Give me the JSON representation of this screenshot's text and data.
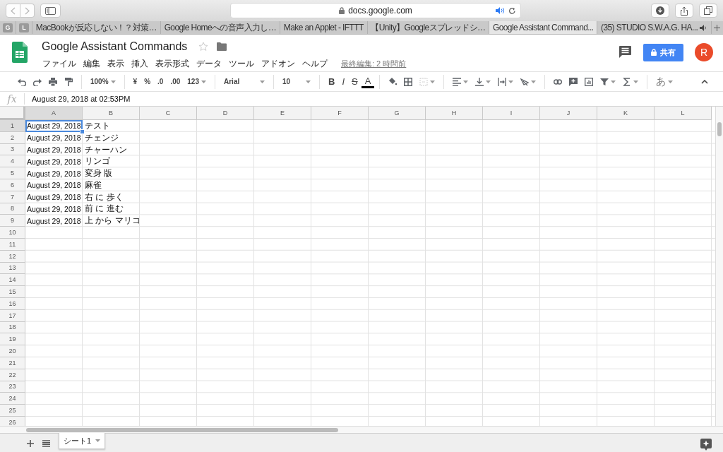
{
  "browser": {
    "address": "docs.google.com",
    "pinned_tabs": [
      "G",
      "L"
    ],
    "tabs": [
      {
        "label": "MacBookが反応しない！？対策…",
        "selected": false,
        "audio": false
      },
      {
        "label": "Google Homeへの音声入力し…",
        "selected": false,
        "audio": false
      },
      {
        "label": "Make an Applet - IFTTT",
        "selected": false,
        "audio": false
      },
      {
        "label": "【Unity】Googleスプレッドシ…",
        "selected": false,
        "audio": false
      },
      {
        "label": "Google Assistant Command...",
        "selected": true,
        "audio": false
      },
      {
        "label": "(35) STUDIO S.W.A.G. HA...",
        "selected": false,
        "audio": true
      }
    ]
  },
  "document": {
    "title": "Google Assistant Commands",
    "menu": [
      "ファイル",
      "編集",
      "表示",
      "挿入",
      "表示形式",
      "データ",
      "ツール",
      "アドオン",
      "ヘルプ"
    ],
    "last_edit": "最終編集: 2 時間前",
    "share": "共有",
    "avatar": "R"
  },
  "toolbar": {
    "zoom": "100%",
    "currency": "¥",
    "percent": "%",
    "decrease_decimal": ".0",
    "increase_decimal": ".00",
    "number_format": "123",
    "font": "Arial",
    "font_size": "10",
    "bold": "B",
    "italic": "I",
    "strikethrough": "S",
    "text_color": "A",
    "input_tools": "あ"
  },
  "formula_bar": {
    "label": "fx",
    "value": "August 29, 2018 at 02:53PM"
  },
  "sheet": {
    "columns": [
      {
        "label": "A",
        "selected": true
      },
      {
        "label": "B",
        "selected": false
      },
      {
        "label": "C",
        "selected": false
      },
      {
        "label": "D",
        "selected": false
      },
      {
        "label": "E",
        "selected": false
      },
      {
        "label": "F",
        "selected": false
      },
      {
        "label": "G",
        "selected": false
      },
      {
        "label": "H",
        "selected": false
      },
      {
        "label": "I",
        "selected": false
      },
      {
        "label": "J",
        "selected": false
      },
      {
        "label": "K",
        "selected": false
      },
      {
        "label": "L",
        "selected": false
      }
    ],
    "rows": [
      {
        "number": "1",
        "selected": true,
        "cells": [
          {
            "text": "August 29, 2018",
            "selected": true
          },
          {
            "text": "テスト",
            "selected": false
          }
        ]
      },
      {
        "number": "2",
        "selected": false,
        "cells": [
          {
            "text": "August 29, 2018",
            "selected": false
          },
          {
            "text": "チェンジ",
            "selected": false
          }
        ]
      },
      {
        "number": "3",
        "selected": false,
        "cells": [
          {
            "text": "August 29, 2018",
            "selected": false
          },
          {
            "text": "チャーハン",
            "selected": false
          }
        ]
      },
      {
        "number": "4",
        "selected": false,
        "cells": [
          {
            "text": "August 29, 2018",
            "selected": false
          },
          {
            "text": "リンゴ",
            "selected": false
          }
        ]
      },
      {
        "number": "5",
        "selected": false,
        "cells": [
          {
            "text": "August 29, 2018",
            "selected": false
          },
          {
            "text": "変身 版",
            "selected": false
          }
        ]
      },
      {
        "number": "6",
        "selected": false,
        "cells": [
          {
            "text": "August 29, 2018",
            "selected": false
          },
          {
            "text": "麻雀",
            "selected": false
          }
        ]
      },
      {
        "number": "7",
        "selected": false,
        "cells": [
          {
            "text": "August 29, 2018",
            "selected": false
          },
          {
            "text": "右 に 歩く",
            "selected": false
          }
        ]
      },
      {
        "number": "8",
        "selected": false,
        "cells": [
          {
            "text": "August 29, 2018",
            "selected": false
          },
          {
            "text": "前 に 進む",
            "selected": false
          }
        ]
      },
      {
        "number": "9",
        "selected": false,
        "cells": [
          {
            "text": "August 29, 2018",
            "selected": false
          },
          {
            "text": "上 から マリコ",
            "selected": false
          }
        ]
      },
      {
        "number": "10",
        "selected": false
      },
      {
        "number": "11",
        "selected": false
      },
      {
        "number": "12",
        "selected": false
      },
      {
        "number": "13",
        "selected": false
      },
      {
        "number": "14",
        "selected": false
      },
      {
        "number": "15",
        "selected": false
      },
      {
        "number": "16",
        "selected": false
      },
      {
        "number": "17",
        "selected": false
      },
      {
        "number": "18",
        "selected": false
      },
      {
        "number": "19",
        "selected": false
      },
      {
        "number": "20",
        "selected": false
      },
      {
        "number": "21",
        "selected": false
      },
      {
        "number": "22",
        "selected": false
      },
      {
        "number": "23",
        "selected": false
      },
      {
        "number": "24",
        "selected": false
      },
      {
        "number": "25",
        "selected": false
      },
      {
        "number": "26",
        "selected": false
      }
    ]
  },
  "sheet_tabs": [
    {
      "label": "シート1",
      "selected": true
    }
  ]
}
